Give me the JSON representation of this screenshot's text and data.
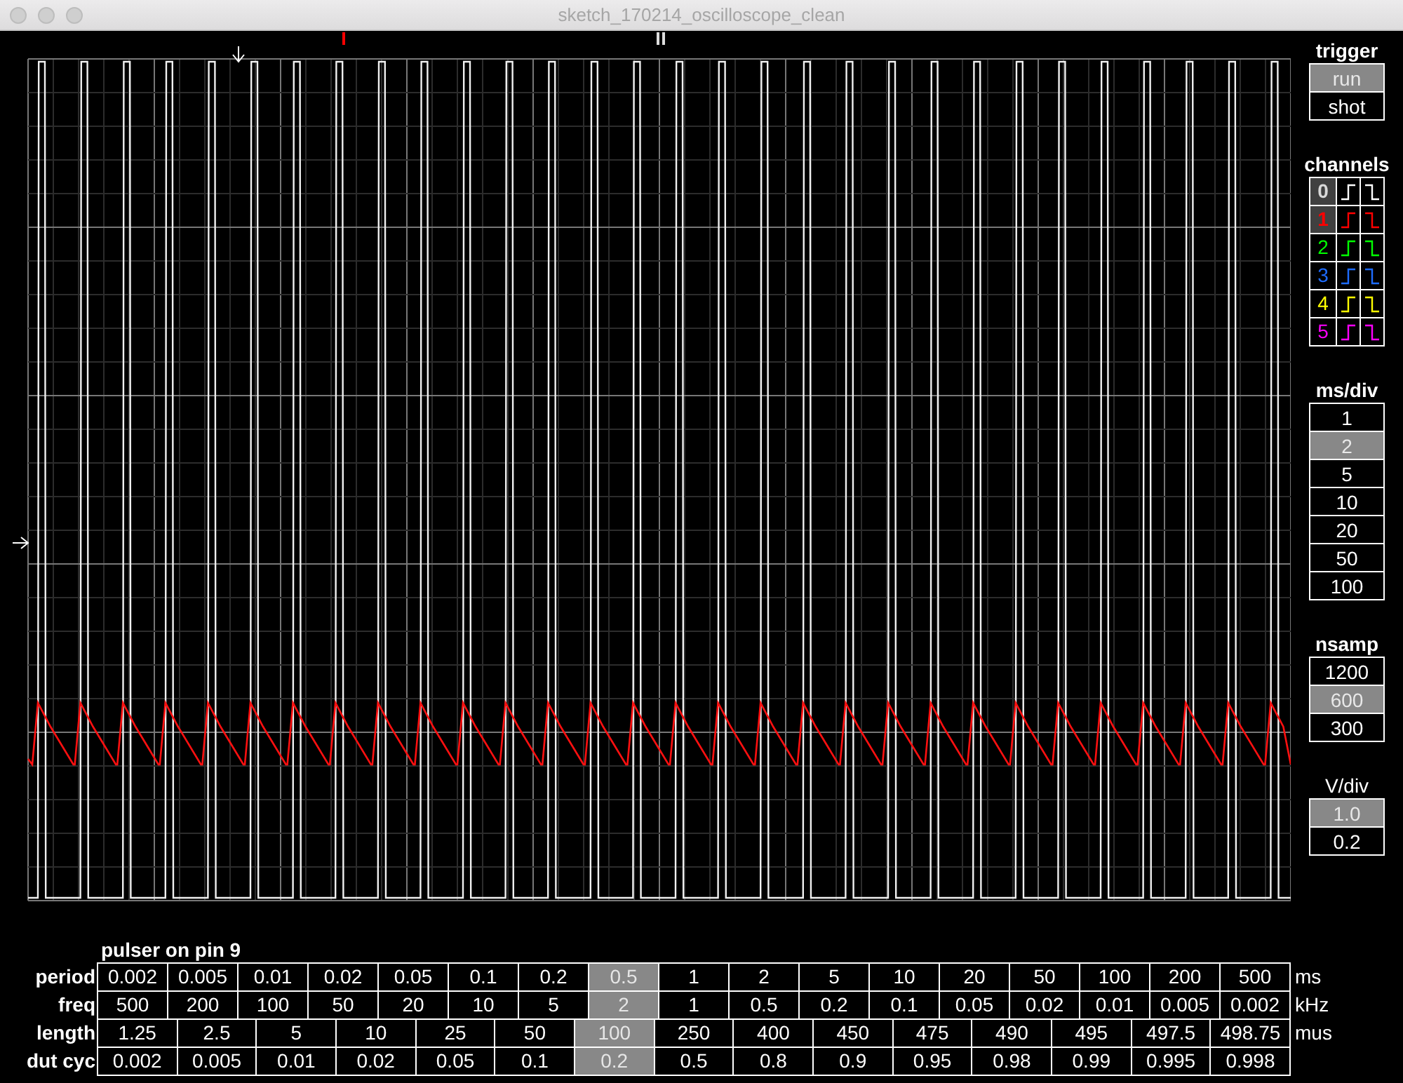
{
  "window": {
    "title": "sketch_170214_oscilloscope_clean"
  },
  "trigger": {
    "label": "trigger",
    "options": [
      {
        "label": "run",
        "selected": true
      },
      {
        "label": "shot",
        "selected": false
      }
    ]
  },
  "channels": {
    "label": "channels",
    "items": [
      {
        "label": "0",
        "color": "#ffffff",
        "on": true
      },
      {
        "label": "1",
        "color": "#ff0000",
        "on": true
      },
      {
        "label": "2",
        "color": "#00ff00",
        "on": false
      },
      {
        "label": "3",
        "color": "#1e6cff",
        "on": false
      },
      {
        "label": "4",
        "color": "#ffff00",
        "on": false
      },
      {
        "label": "5",
        "color": "#ff00ff",
        "on": false
      }
    ]
  },
  "ms_div": {
    "label": "ms/div",
    "options": [
      {
        "label": "1",
        "selected": false
      },
      {
        "label": "2",
        "selected": true
      },
      {
        "label": "5",
        "selected": false
      },
      {
        "label": "10",
        "selected": false
      },
      {
        "label": "20",
        "selected": false
      },
      {
        "label": "50",
        "selected": false
      },
      {
        "label": "100",
        "selected": false
      }
    ]
  },
  "nsamp": {
    "label": "nsamp",
    "options": [
      {
        "label": "1200",
        "selected": false
      },
      {
        "label": "600",
        "selected": true
      },
      {
        "label": "300",
        "selected": false
      }
    ]
  },
  "v_div": {
    "label": "V/div",
    "options": [
      {
        "label": "1.0",
        "selected": true
      },
      {
        "label": "0.2",
        "selected": false
      }
    ]
  },
  "pulser": {
    "title": "pulser on pin 9",
    "rows": [
      {
        "label": "period",
        "unit": "ms",
        "cells": [
          {
            "value": "0.002",
            "selected": false
          },
          {
            "value": "0.005",
            "selected": false
          },
          {
            "value": "0.01",
            "selected": false
          },
          {
            "value": "0.02",
            "selected": false
          },
          {
            "value": "0.05",
            "selected": false
          },
          {
            "value": "0.1",
            "selected": false
          },
          {
            "value": "0.2",
            "selected": false
          },
          {
            "value": "0.5",
            "selected": true
          },
          {
            "value": "1",
            "selected": false
          },
          {
            "value": "2",
            "selected": false
          },
          {
            "value": "5",
            "selected": false
          },
          {
            "value": "10",
            "selected": false
          },
          {
            "value": "20",
            "selected": false
          },
          {
            "value": "50",
            "selected": false
          },
          {
            "value": "100",
            "selected": false
          },
          {
            "value": "200",
            "selected": false
          },
          {
            "value": "500",
            "selected": false
          }
        ]
      },
      {
        "label": "freq",
        "unit": "kHz",
        "cells": [
          {
            "value": "500",
            "selected": false
          },
          {
            "value": "200",
            "selected": false
          },
          {
            "value": "100",
            "selected": false
          },
          {
            "value": "50",
            "selected": false
          },
          {
            "value": "20",
            "selected": false
          },
          {
            "value": "10",
            "selected": false
          },
          {
            "value": "5",
            "selected": false
          },
          {
            "value": "2",
            "selected": true
          },
          {
            "value": "1",
            "selected": false
          },
          {
            "value": "0.5",
            "selected": false
          },
          {
            "value": "0.2",
            "selected": false
          },
          {
            "value": "0.1",
            "selected": false
          },
          {
            "value": "0.05",
            "selected": false
          },
          {
            "value": "0.02",
            "selected": false
          },
          {
            "value": "0.01",
            "selected": false
          },
          {
            "value": "0.005",
            "selected": false
          },
          {
            "value": "0.002",
            "selected": false
          }
        ]
      },
      {
        "label": "length",
        "unit": "mus",
        "cells": [
          {
            "value": "1.25",
            "selected": false
          },
          {
            "value": "2.5",
            "selected": false
          },
          {
            "value": "5",
            "selected": false
          },
          {
            "value": "10",
            "selected": false
          },
          {
            "value": "25",
            "selected": false
          },
          {
            "value": "50",
            "selected": false
          },
          {
            "value": "100",
            "selected": true
          },
          {
            "value": "250",
            "selected": false
          },
          {
            "value": "400",
            "selected": false
          },
          {
            "value": "450",
            "selected": false
          },
          {
            "value": "475",
            "selected": false
          },
          {
            "value": "490",
            "selected": false
          },
          {
            "value": "495",
            "selected": false
          },
          {
            "value": "497.5",
            "selected": false
          },
          {
            "value": "498.75",
            "selected": false
          }
        ]
      },
      {
        "label": "dut cyc",
        "cells": [
          {
            "value": "0.002",
            "selected": false
          },
          {
            "value": "0.005",
            "selected": false
          },
          {
            "value": "0.01",
            "selected": false
          },
          {
            "value": "0.02",
            "selected": false
          },
          {
            "value": "0.05",
            "selected": false
          },
          {
            "value": "0.1",
            "selected": false
          },
          {
            "value": "0.2",
            "selected": true
          },
          {
            "value": "0.5",
            "selected": false
          },
          {
            "value": "0.8",
            "selected": false
          },
          {
            "value": "0.9",
            "selected": false
          },
          {
            "value": "0.95",
            "selected": false
          },
          {
            "value": "0.98",
            "selected": false
          },
          {
            "value": "0.99",
            "selected": false
          },
          {
            "value": "0.995",
            "selected": false
          },
          {
            "value": "0.998",
            "selected": false
          }
        ]
      }
    ]
  }
}
